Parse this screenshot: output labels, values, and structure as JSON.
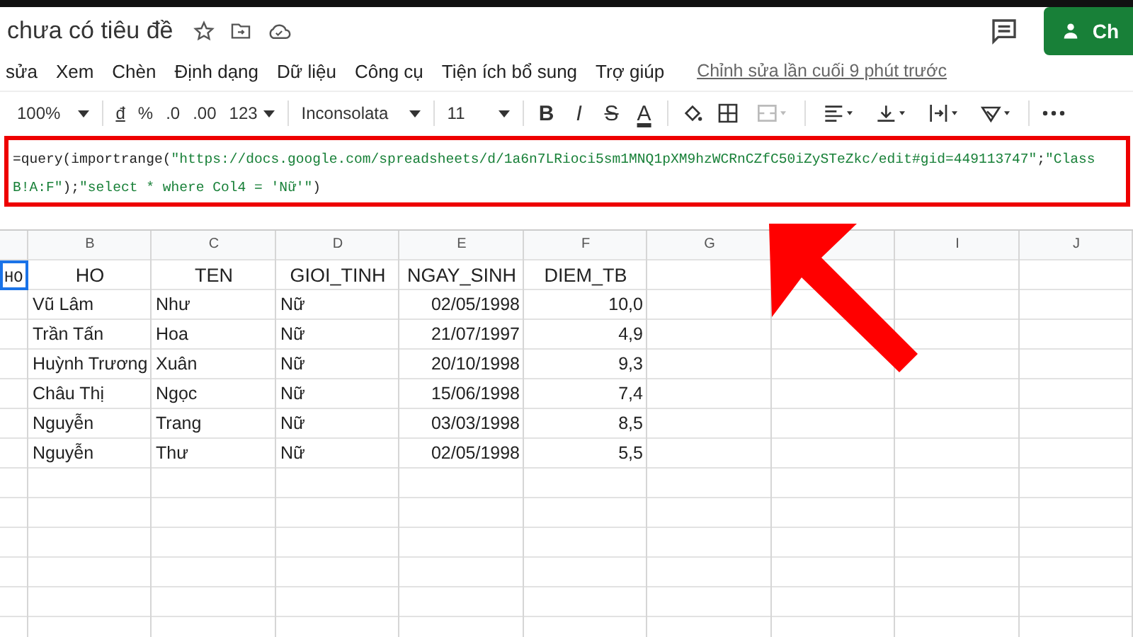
{
  "document": {
    "title": "chưa có tiêu đề",
    "share_button": "Ch"
  },
  "menu": [
    "sửa",
    "Xem",
    "Chèn",
    "Định dạng",
    "Dữ liệu",
    "Công cụ",
    "Tiện ích bổ sung",
    "Trợ giúp"
  ],
  "last_edit": "Chỉnh sửa lần cuối 9 phút trước",
  "toolbar": {
    "zoom": "100%",
    "currency": "đ",
    "percent": "%",
    "decrease_decimals": ".0",
    "increase_decimals": ".00",
    "format": "123",
    "font": "Inconsolata",
    "font_size": "11",
    "bold": "B",
    "italic": "I",
    "strikethrough": "S",
    "text_color": "A",
    "merge_disabled": true
  },
  "formula": [
    {
      "kind": "plain",
      "text": "=query(importrange("
    },
    {
      "kind": "string",
      "text": "\"https://docs.google.com/spreadsheets/d/1a6n7LRioci5sm1MNQ1pXM9hzWCRnCZfC50iZySTeZkc/edit#gid=449113747\""
    },
    {
      "kind": "plain",
      "text": ";"
    },
    {
      "kind": "string",
      "text": "\"Class B!A:F\""
    },
    {
      "kind": "plain",
      "text": ");"
    },
    {
      "kind": "string",
      "text": "\"select * where Col4 = 'Nữ'\""
    },
    {
      "kind": "plain",
      "text": ")"
    }
  ],
  "partial_column_a": {
    "text": "HO",
    "selected": true
  },
  "table": {
    "columns": [
      {
        "letter": "B"
      },
      {
        "letter": "C"
      },
      {
        "letter": "D"
      },
      {
        "letter": "E"
      },
      {
        "letter": "F"
      },
      {
        "letter": "G"
      },
      {},
      {
        "letter": "I"
      },
      {
        "letter": "J"
      }
    ],
    "rows": [
      {
        "cells": [
          {
            "text": "HO",
            "selected": false
          },
          {
            "text": "TEN",
            "selected": false
          },
          {
            "text": "GIOI_TINH",
            "selected": false
          },
          {
            "text": "NGAY_SINH",
            "selected": false
          },
          {
            "text": "DIEM_TB",
            "selected": false
          }
        ]
      },
      {
        "cells": [
          {
            "text": "Vũ Lâm",
            "selected": false
          },
          {
            "text": "Như",
            "selected": false
          },
          {
            "text": "Nữ",
            "selected": false
          },
          {
            "text": "02/05/1998",
            "selected": false
          },
          {
            "text": "10,0",
            "selected": false
          }
        ]
      },
      {
        "cells": [
          {
            "text": "Trần Tấn",
            "selected": false
          },
          {
            "text": "Hoa",
            "selected": false
          },
          {
            "text": "Nữ",
            "selected": false
          },
          {
            "text": "21/07/1997",
            "selected": false
          },
          {
            "text": "4,9",
            "selected": false
          }
        ]
      },
      {
        "cells": [
          {
            "text": "Huỳnh Trương",
            "selected": false
          },
          {
            "text": "Xuân",
            "selected": false
          },
          {
            "text": "Nữ",
            "selected": false
          },
          {
            "text": "20/10/1998",
            "selected": false
          },
          {
            "text": "9,3",
            "selected": false
          }
        ]
      },
      {
        "cells": [
          {
            "text": "Châu Thị",
            "selected": false
          },
          {
            "text": "Ngọc",
            "selected": false
          },
          {
            "text": "Nữ",
            "selected": false
          },
          {
            "text": "15/06/1998",
            "selected": false
          },
          {
            "text": "7,4",
            "selected": false
          }
        ]
      },
      {
        "cells": [
          {
            "text": "Nguyễn",
            "selected": false
          },
          {
            "text": "Trang",
            "selected": false
          },
          {
            "text": "Nữ",
            "selected": false
          },
          {
            "text": "03/03/1998",
            "selected": false
          },
          {
            "text": "8,5",
            "selected": false
          }
        ]
      },
      {
        "cells": [
          {
            "text": "Nguyễn",
            "selected": false
          },
          {
            "text": "Thư",
            "selected": false
          },
          {
            "text": "Nữ",
            "selected": false
          },
          {
            "text": "02/05/1998",
            "selected": false
          },
          {
            "text": "5,5",
            "selected": false
          }
        ]
      }
    ]
  }
}
